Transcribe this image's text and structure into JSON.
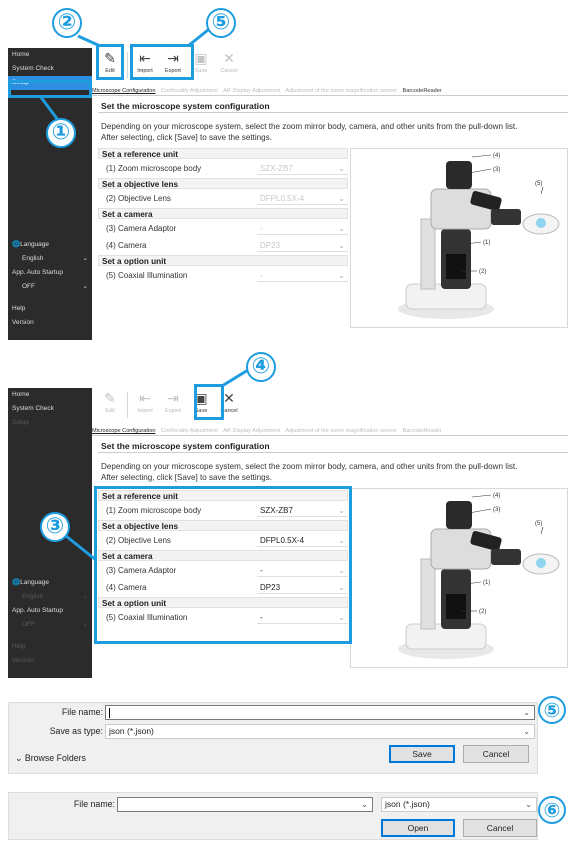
{
  "sidebar": {
    "items": [
      "Home",
      "System Check",
      "Setup"
    ],
    "language_label": "Language",
    "language_value": "English",
    "auto_label": "App. Auto Startup",
    "auto_value": "OFF",
    "help": "Help",
    "version": "Version"
  },
  "toolbar": {
    "edit": "Edit",
    "import": "Import",
    "export": "Export",
    "save": "Save",
    "cancel": "Cancel"
  },
  "tabs": [
    "Microscope Configuration",
    "Confocality Adjustment",
    "AR Display Adjustment",
    "Adjustment of the zoom magnification sensor",
    "BarcodeReader"
  ],
  "page": {
    "title": "Set the microscope system configuration",
    "desc1": "Depending on your microscope system, select the zoom mirror body, camera, and other units from the pull-down list.",
    "desc2": "After selecting, click [Save] to save the settings."
  },
  "groups": [
    {
      "title": "Set a reference unit",
      "rows": [
        {
          "label": "(1) Zoom microscope body",
          "value": "SZX-ZB7"
        }
      ]
    },
    {
      "title": "Set a objective lens",
      "rows": [
        {
          "label": "(2) Objective Lens",
          "value": "DFPL0.5X-4"
        }
      ]
    },
    {
      "title": "Set a camera",
      "rows": [
        {
          "label": "(3) Camera Adaptor",
          "value": "-"
        },
        {
          "label": "(4) Camera",
          "value": "DP23"
        }
      ]
    },
    {
      "title": "Set a option unit",
      "rows": [
        {
          "label": "(5) Coaxial Illumination",
          "value": "-"
        }
      ]
    }
  ],
  "figure_labels": [
    "(4)",
    "(3)",
    "(5)",
    "(1)",
    "(2)"
  ],
  "callouts": [
    "①",
    "②",
    "③",
    "④",
    "⑤",
    "⑥"
  ],
  "save_dialog": {
    "file_name_label": "File name:",
    "file_name_value": "",
    "type_label": "Save as type:",
    "type_value": "json (*.json)",
    "browse": "Browse Folders",
    "save": "Save",
    "cancel": "Cancel"
  },
  "open_dialog": {
    "file_name_label": "File name:",
    "file_name_value": "",
    "type_value": "json (*.json)",
    "open": "Open",
    "cancel": "Cancel"
  },
  "colors": {
    "accent": "#1e9ce0",
    "sidebar": "#2b2b2b",
    "selected": "#2b8ee0"
  }
}
